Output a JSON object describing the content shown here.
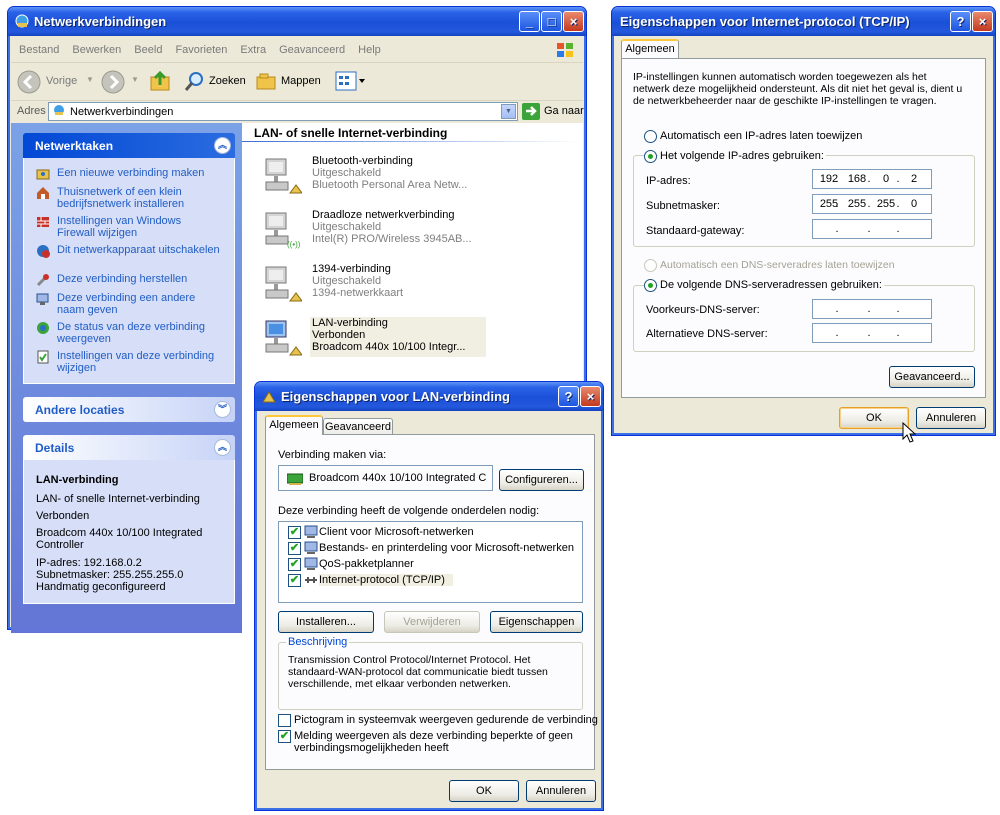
{
  "explorer": {
    "title": "Netwerkverbindingen",
    "menu": [
      "Bestand",
      "Bewerken",
      "Beeld",
      "Favorieten",
      "Extra",
      "Geavanceerd",
      "Help"
    ],
    "toolbar": {
      "back": "Vorige",
      "search": "Zoeken",
      "folders": "Mappen"
    },
    "address": {
      "label": "Adres",
      "value": "Netwerkverbindingen",
      "go": "Ga naar"
    },
    "network_tasks": {
      "title": "Netwerktaken",
      "items": [
        "Een nieuwe verbinding maken",
        "Thuisnetwerk of een klein bedrijfsnetwerk installeren",
        "Instellingen van Windows Firewall wijzigen",
        "Dit netwerkapparaat uitschakelen",
        "Deze verbinding herstellen",
        "Deze verbinding een andere naam geven",
        "De status van deze verbinding weergeven",
        "Instellingen van deze verbinding wijzigen"
      ]
    },
    "other_places": {
      "title": "Andere locaties"
    },
    "details": {
      "title": "Details",
      "name": "LAN-verbinding",
      "lines": [
        "LAN- of snelle Internet-verbinding",
        "Verbonden",
        "Broadcom 440x 10/100 Integrated Controller",
        "IP-adres: 192.168.0.2",
        "Subnetmasker: 255.255.255.0",
        "Handmatig geconfigureerd"
      ]
    },
    "group_header": "LAN- of snelle Internet-verbinding",
    "connections": [
      {
        "name": "Bluetooth-verbinding",
        "status": "Uitgeschakeld",
        "device": "Bluetooth Personal Area Netw..."
      },
      {
        "name": "Draadloze netwerkverbinding",
        "status": "Uitgeschakeld",
        "device": "Intel(R) PRO/Wireless 3945AB..."
      },
      {
        "name": "1394-verbinding",
        "status": "Uitgeschakeld",
        "device": "1394-netwerkkaart"
      },
      {
        "name": "LAN-verbinding",
        "status": "Verbonden",
        "device": "Broadcom 440x 10/100 Integr..."
      }
    ]
  },
  "lan_dialog": {
    "title": "Eigenschappen voor LAN-verbinding",
    "tabs": [
      "Algemeen",
      "Geavanceerd"
    ],
    "connect_via_label": "Verbinding maken via:",
    "adapter": "Broadcom 440x 10/100 Integrated C",
    "configure": "Configureren...",
    "components_label": "Deze verbinding heeft de volgende onderdelen nodig:",
    "components": [
      "Client voor Microsoft-netwerken",
      "Bestands- en printerdeling voor Microsoft-netwerken",
      "QoS-pakketplanner",
      "Internet-protocol (TCP/IP)"
    ],
    "install": "Installeren...",
    "remove": "Verwijderen",
    "properties": "Eigenschappen",
    "description_label": "Beschrijving",
    "description": "Transmission Control Protocol/Internet Protocol. Het standaard-WAN-protocol dat communicatie biedt tussen verschillende, met elkaar verbonden netwerken.",
    "tray_icon": "Pictogram in systeemvak weergeven gedurende de verbinding",
    "notify": "Melding weergeven als deze verbinding beperkte of geen verbindingsmogelijkheden heeft",
    "ok": "OK",
    "cancel": "Annuleren"
  },
  "tcp_dialog": {
    "title": "Eigenschappen voor Internet-protocol (TCP/IP)",
    "tab": "Algemeen",
    "info": "IP-instellingen kunnen automatisch worden toegewezen als het netwerk deze mogelijkheid ondersteunt. Als dit niet het geval is, dient u de netwerkbeheerder naar de geschikte IP-instellingen te vragen.",
    "auto_ip": "Automatisch een IP-adres laten toewijzen",
    "manual_ip": "Het volgende IP-adres gebruiken:",
    "ip_label": "IP-adres:",
    "ip": [
      "192",
      "168",
      "0",
      "2"
    ],
    "mask_label": "Subnetmasker:",
    "mask": [
      "255",
      "255",
      "255",
      "0"
    ],
    "gateway_label": "Standaard-gateway:",
    "auto_dns": "Automatisch een DNS-serveradres laten toewijzen",
    "manual_dns": "De volgende DNS-serveradressen gebruiken:",
    "pref_dns": "Voorkeurs-DNS-server:",
    "alt_dns": "Alternatieve DNS-server:",
    "dot": ".",
    "advanced": "Geavanceerd...",
    "ok": "OK",
    "cancel": "Annuleren"
  },
  "window_buttons": {
    "minimize": "_",
    "maximize": "□",
    "close": "×",
    "help": "?"
  }
}
